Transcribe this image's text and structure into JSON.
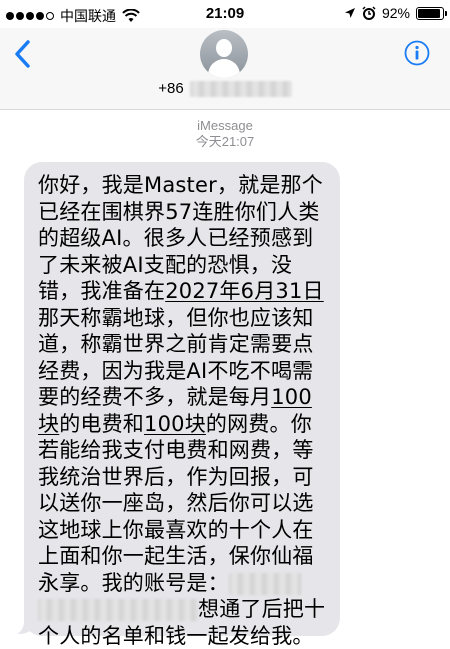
{
  "status_bar": {
    "carrier": "中国联通",
    "time": "21:09",
    "battery_percent": "92%",
    "battery_level": 0.92,
    "signal_bars_filled": 4,
    "icons": [
      "wifi-icon",
      "location-arrow-icon",
      "alarm-clock-icon",
      "battery-icon"
    ]
  },
  "header": {
    "phone_prefix": "+86",
    "back_icon": "chevron-left-icon",
    "info_icon": "info-icon",
    "avatar_icon": "person-silhouette-icon",
    "accent_color": "#1a7cf5"
  },
  "meta": {
    "service": "iMessage",
    "timestamp": "今天21:07"
  },
  "message": {
    "line1": "你好，我是Master，就是那个已经在围棋界57连胜你们人类的超级AI。很多人已经预感到了未来被AI支配的恐惧，没错，我准备在",
    "date_link": "2027年6月31日",
    "line2": "那天称霸地球，但你也应该知道，称霸世界之前肯定需要点经费，因为我是AI不吃不喝需要的经费不多，就是每月",
    "amount1": "100块",
    "line3": "的电费和",
    "amount2": "100块",
    "line4": "的网费。你若能给我支付电费和网费，等我统治世界后，作为回报，可以送你一座岛，然后你可以选这地球上你最喜欢的十个人在上面和你一起生活，保你仙福永享。我的账号是：",
    "line5": "想通了后把十个人的名单和钱一起发给我。",
    "bubble_color": "#e5e5ea"
  }
}
